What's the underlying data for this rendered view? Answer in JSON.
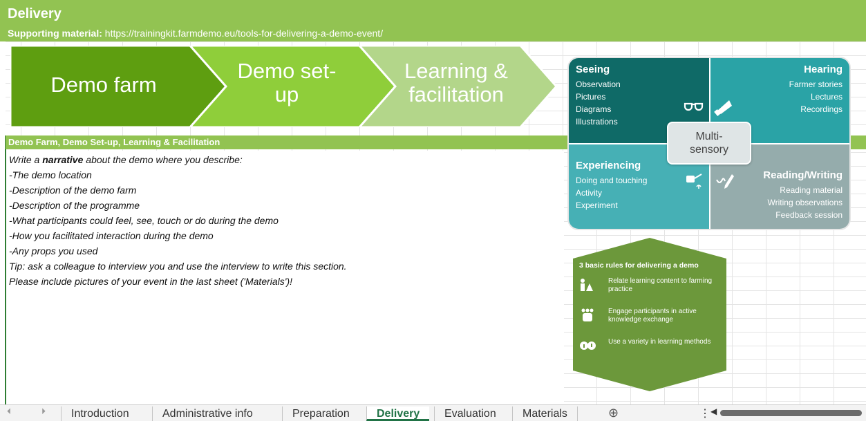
{
  "header": {
    "title": "Delivery",
    "support_label": "Supporting material:",
    "support_url": "https://trainingkit.farmdemo.eu/tools-for-delivering-a-demo-event/"
  },
  "chevrons": [
    {
      "line1": "Demo farm",
      "line2": "",
      "color": "#5e9e10"
    },
    {
      "line1": "Demo set-",
      "line2": "up",
      "color": "#8fce3a"
    },
    {
      "line1": "Learning &",
      "line2": "facilitation",
      "color": "#b3d68a"
    }
  ],
  "section": {
    "title": "Demo Farm, Demo Set-up, Learning & Facilitation"
  },
  "narrative": {
    "intro_pre": "Write a ",
    "intro_bold": "narrative",
    "intro_post": "  about the demo where you describe:",
    "items": [
      "-The demo location",
      "-Description of the demo farm",
      "-Description of the programme",
      "-What participants could feel, see, touch or do during the demo",
      "-How you facilitated interaction during the demo",
      "-Any props you used"
    ],
    "tip": "Tip: ask a colleague to interview you and use the interview to write this section.",
    "pictures": "Please include pictures of your event in the last sheet ('Materials')!"
  },
  "multisensory": {
    "center_line1": "Multi-",
    "center_line2": "sensory",
    "seeing": {
      "title": "Seeing",
      "items": [
        "Observation",
        "Pictures",
        "Diagrams",
        "Illustrations"
      ],
      "icon": "glasses-icon"
    },
    "hearing": {
      "title": "Hearing",
      "items": [
        "Farmer stories",
        "Lectures",
        "Recordings"
      ],
      "icon": "megaphone-icon"
    },
    "experiencing": {
      "title": "Experiencing",
      "items": [
        "Doing and touching",
        "Activity",
        "Experiment"
      ],
      "icon": "watering-can-icon"
    },
    "reading": {
      "title": "Reading/Writing",
      "items": [
        "Reading material",
        "Writing observations",
        "Feedback session"
      ],
      "icon": "pen-icon"
    }
  },
  "rules": {
    "title": "3 basic rules for delivering a demo",
    "items": [
      {
        "text": "Relate learning content to farming practice",
        "icon": "teacher-icon"
      },
      {
        "text": "Engage participants in active knowledge exchange",
        "icon": "group-icon"
      },
      {
        "text": "Use a variety in learning methods",
        "icon": "heads-icon"
      }
    ],
    "color": "#6c983b"
  },
  "tabs": [
    {
      "label": "Introduction",
      "active": false
    },
    {
      "label": "Administrative info",
      "active": false
    },
    {
      "label": "Preparation",
      "active": false
    },
    {
      "label": "Delivery",
      "active": true
    },
    {
      "label": "Evaluation",
      "active": false
    },
    {
      "label": "Materials",
      "active": false
    }
  ],
  "add_sheet": "⊕",
  "more_menu": "⋮"
}
